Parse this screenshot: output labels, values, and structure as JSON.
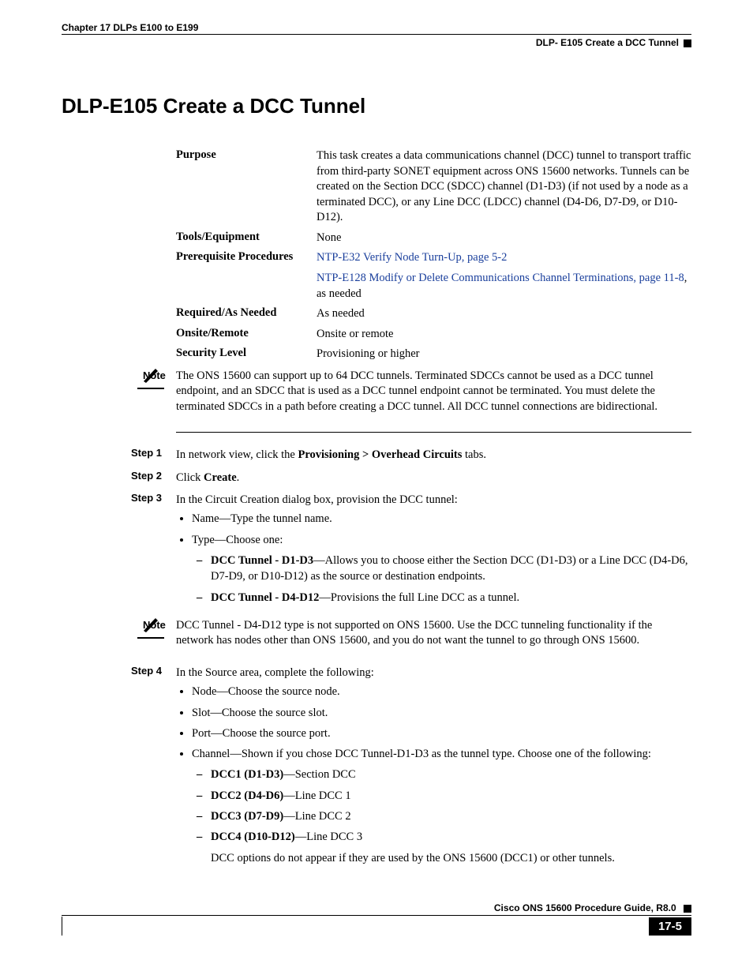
{
  "header": {
    "chapter": "Chapter 17 DLPs E100 to E199",
    "section": "DLP- E105 Create a DCC Tunnel"
  },
  "title": "DLP-E105 Create a DCC Tunnel",
  "meta": {
    "purpose_label": "Purpose",
    "purpose_text": "This task creates a data communications channel (DCC) tunnel to transport traffic from third-party SONET equipment across ONS 15600 networks. Tunnels can be created on the Section DCC (SDCC) channel (D1-D3) (if not used by a node as a terminated DCC), or any Line DCC (LDCC) channel (D4-D6, D7-D9, or D10-D12).",
    "tools_label": "Tools/Equipment",
    "tools_text": "None",
    "prereq_label": "Prerequisite Procedures",
    "prereq_link1": "NTP-E32 Verify Node Turn-Up, page 5-2",
    "prereq_link2_a": "NTP-E128 Modify or Delete Communications Channel Terminations, page 11-8",
    "prereq_link2_tail": ", as needed",
    "required_label": "Required/As Needed",
    "required_text": "As needed",
    "onsite_label": "Onsite/Remote",
    "onsite_text": "Onsite or remote",
    "security_label": "Security Level",
    "security_text": "Provisioning or higher"
  },
  "note1": {
    "label": "Note",
    "text": "The ONS 15600 can support up to 64 DCC tunnels. Terminated SDCCs cannot be used as a DCC tunnel endpoint, and an SDCC that is used as a DCC tunnel endpoint cannot be terminated. You must delete the terminated SDCCs in a path before creating a DCC tunnel. All DCC tunnel connections are bidirectional."
  },
  "steps": {
    "s1_label": "Step 1",
    "s1_pre": "In network view, click the ",
    "s1_bold": "Provisioning > Overhead Circuits",
    "s1_post": " tabs.",
    "s2_label": "Step 2",
    "s2_pre": "Click ",
    "s2_bold": "Create",
    "s2_post": ".",
    "s3_label": "Step 3",
    "s3_text": "In the Circuit Creation dialog box, provision the DCC tunnel:",
    "s3_b1": "Name—Type the tunnel name.",
    "s3_b2": "Type—Choose one:",
    "s3_d1_bold": "DCC Tunnel - D1-D3",
    "s3_d1_rest": "—Allows you to choose either the Section DCC (D1-D3) or a Line DCC (D4-D6, D7-D9, or D10-D12) as the source or destination endpoints.",
    "s3_d2_bold": "DCC Tunnel - D4-D12",
    "s3_d2_rest": "—Provisions the full Line DCC as a tunnel.",
    "s4_label": "Step 4",
    "s4_text": "In the Source area, complete the following:",
    "s4_b1": "Node—Choose the source node.",
    "s4_b2": "Slot—Choose the source slot.",
    "s4_b3": "Port—Choose the source port.",
    "s4_b4": "Channel—Shown if you chose DCC Tunnel-D1-D3 as the tunnel type. Choose one of the following:",
    "s4_d1_bold": "DCC1 (D1-D3)",
    "s4_d1_rest": "—Section DCC",
    "s4_d2_bold": "DCC2 (D4-D6)",
    "s4_d2_rest": "—Line DCC 1",
    "s4_d3_bold": "DCC3 (D7-D9)",
    "s4_d3_rest": "—Line DCC 2",
    "s4_d4_bold": "DCC4 (D10-D12)",
    "s4_d4_rest": "—Line DCC 3",
    "s4_trail": "DCC options do not appear if they are used by the ONS 15600 (DCC1) or other tunnels."
  },
  "note2": {
    "label": "Note",
    "text": "DCC Tunnel - D4-D12 type is not supported on ONS 15600. Use the DCC tunneling functionality if the network has nodes other than ONS 15600, and you do not want the tunnel to go through ONS 15600."
  },
  "footer": {
    "guide": "Cisco ONS 15600 Procedure Guide, R8.0",
    "page": "17-5"
  }
}
